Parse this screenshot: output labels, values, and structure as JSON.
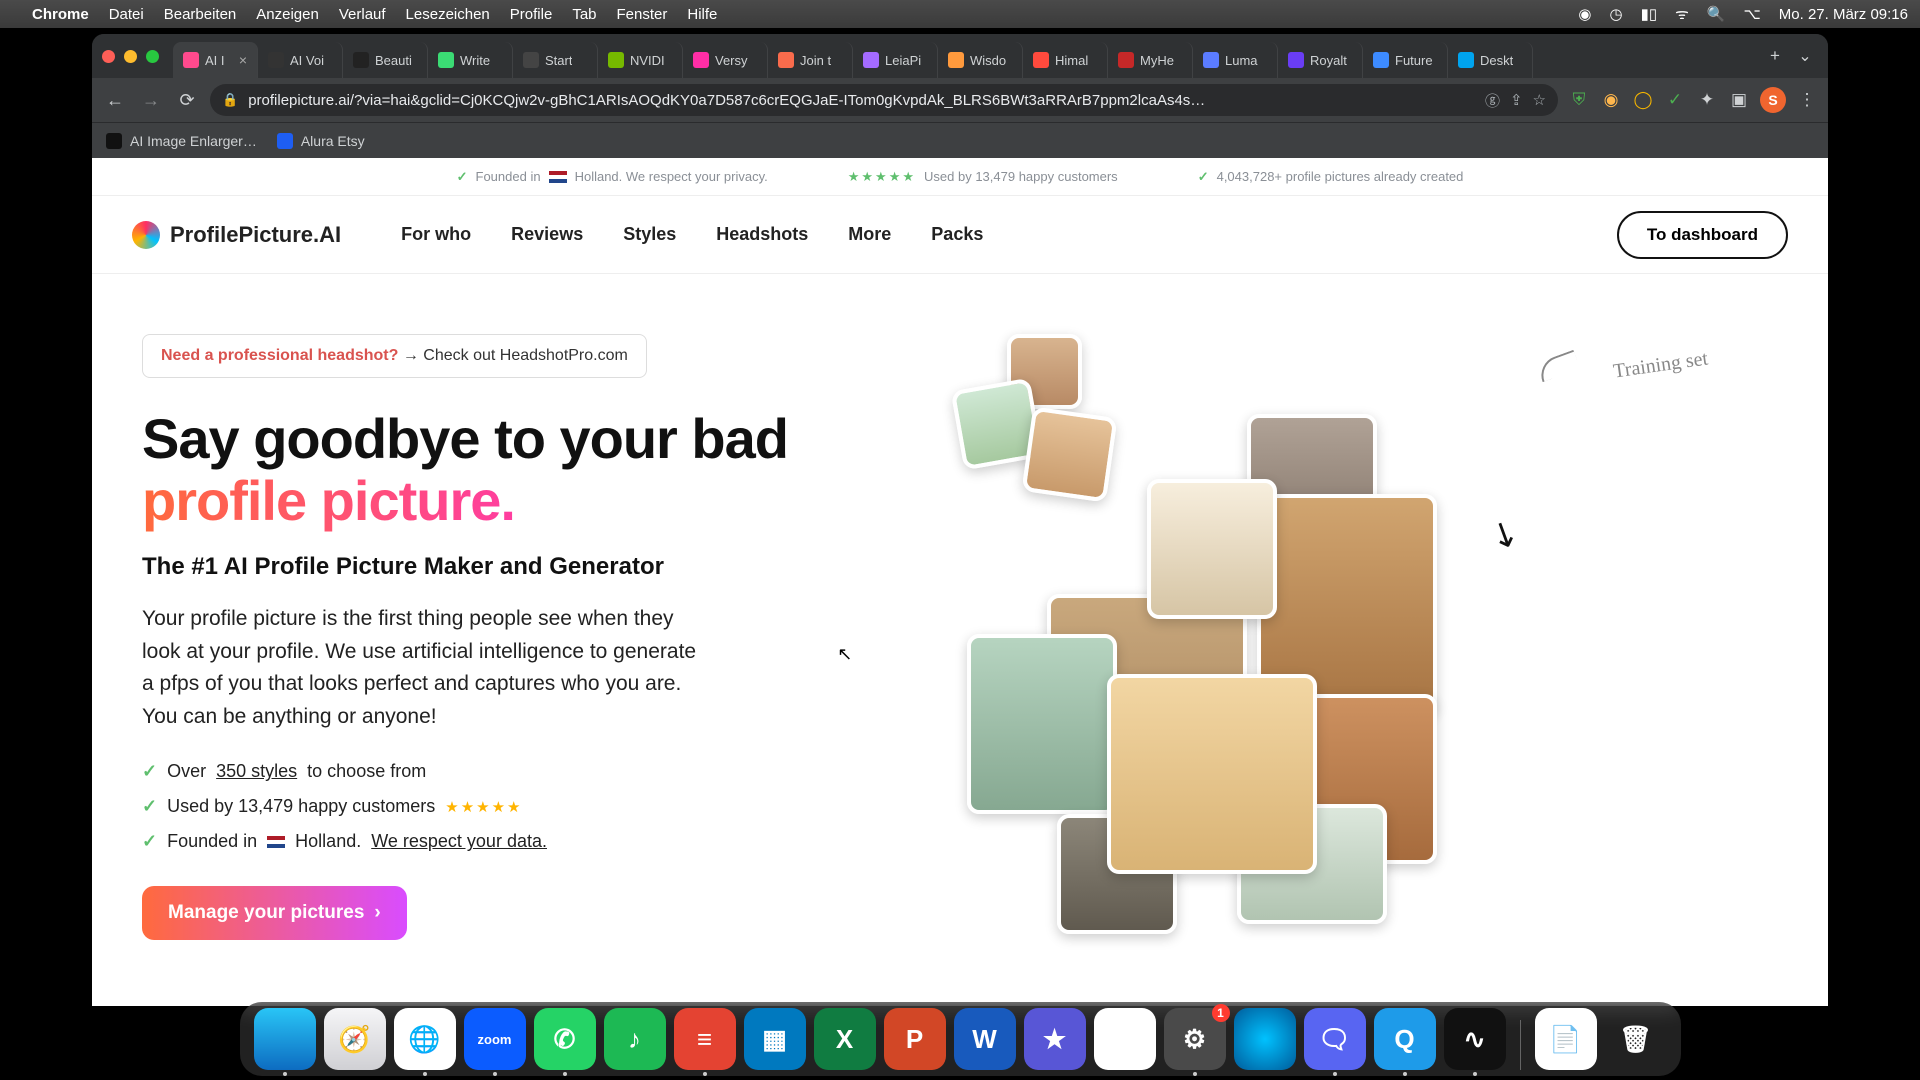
{
  "menubar": {
    "app": "Chrome",
    "items": [
      "Datei",
      "Bearbeiten",
      "Anzeigen",
      "Verlauf",
      "Lesezeichen",
      "Profile",
      "Tab",
      "Fenster",
      "Hilfe"
    ],
    "clock": "Mo. 27. März 09:16"
  },
  "tabs": [
    {
      "label": "AI I",
      "active": true,
      "favcolor": "#ff4a8d"
    },
    {
      "label": "AI Voi",
      "favcolor": "#333"
    },
    {
      "label": "Beauti",
      "favcolor": "#222"
    },
    {
      "label": "Write",
      "favcolor": "#3bdb74"
    },
    {
      "label": "Start",
      "favcolor": "#444"
    },
    {
      "label": "NVIDI",
      "favcolor": "#76b900"
    },
    {
      "label": "Versy",
      "favcolor": "#ff2ea6"
    },
    {
      "label": "Join t",
      "favcolor": "#f96b4c"
    },
    {
      "label": "LeiaPi",
      "favcolor": "#a46bff"
    },
    {
      "label": "Wisdo",
      "favcolor": "#ff9a3d"
    },
    {
      "label": "Himal",
      "favcolor": "#ff4a3d"
    },
    {
      "label": "MyHe",
      "favcolor": "#c62828"
    },
    {
      "label": "Luma",
      "favcolor": "#5b7cff"
    },
    {
      "label": "Royalt",
      "favcolor": "#6a3df5"
    },
    {
      "label": "Future",
      "favcolor": "#3d8bff"
    },
    {
      "label": "Deskt",
      "favcolor": "#00a4ef"
    }
  ],
  "url": "profilepicture.ai/?via=hai&gclid=Cj0KCQjw2v-gBhC1ARIsAOQdKY0a7D587c6crEQGJaE-ITom0gKvpdAk_BLRS6BWt3aRRArB7ppm2lcaAs4s…",
  "bookmarks": [
    {
      "label": "AI Image Enlarger…",
      "favcolor": "#111"
    },
    {
      "label": "Alura Etsy",
      "favcolor": "#1e5ef3"
    }
  ],
  "banner": {
    "privacy_pre": "Founded in",
    "privacy_post": "Holland. We respect your privacy.",
    "customers": "Used by 13,479 happy customers",
    "count": "4,043,728+ profile pictures already created"
  },
  "site": {
    "brand": "ProfilePicture.AI",
    "nav": [
      "For who",
      "Reviews",
      "Styles",
      "Headshots",
      "More",
      "Packs"
    ],
    "dash": "To dashboard"
  },
  "promo": {
    "red": "Need a professional headshot?",
    "rest": " → Check out HeadshotPro.com"
  },
  "hero": {
    "h_pre": "Say goodbye to your bad ",
    "h_grad": "profile picture.",
    "sub": "The #1 AI Profile Picture Maker and Generator",
    "para": "Your profile picture is the first thing people see when they look at your profile. We use artificial intelligence to generate a pfps of you that looks perfect and captures who you are. You can be anything or anyone!",
    "b1_pre": "Over ",
    "b1_link": "350 styles ",
    "b1_post": "to choose from",
    "b2": "Used by 13,479 happy customers",
    "b3_pre": "Founded in ",
    "b3_mid": " Holland. ",
    "b3_link": "We respect your data.",
    "cta": "Manage your pictures",
    "train": "Training set"
  },
  "dock": {
    "apps": [
      {
        "name": "finder",
        "bg": "linear-gradient(#29c5f6,#0d6cc1)",
        "txt": "",
        "dot": true
      },
      {
        "name": "safari",
        "bg": "linear-gradient(#f5f5f7,#d0d0d4)",
        "txt": "🧭",
        "dot": false
      },
      {
        "name": "chrome",
        "bg": "#fff",
        "txt": "🌐",
        "dot": true
      },
      {
        "name": "zoom",
        "bg": "#0b5cff",
        "txt": "zoom",
        "dot": true,
        "fs": "13px"
      },
      {
        "name": "whatsapp",
        "bg": "#25d366",
        "txt": "✆",
        "dot": true
      },
      {
        "name": "spotify",
        "bg": "#1db954",
        "txt": "♪",
        "dot": false
      },
      {
        "name": "todoist",
        "bg": "#e44332",
        "txt": "≡",
        "dot": true
      },
      {
        "name": "trello",
        "bg": "#0079bf",
        "txt": "▦",
        "dot": false
      },
      {
        "name": "excel",
        "bg": "#107c41",
        "txt": "X",
        "dot": false
      },
      {
        "name": "powerpoint",
        "bg": "#d24726",
        "txt": "P",
        "dot": false
      },
      {
        "name": "word",
        "bg": "#185abd",
        "txt": "W",
        "dot": false
      },
      {
        "name": "imovie",
        "bg": "#5856d6",
        "txt": "★",
        "dot": false
      },
      {
        "name": "drive",
        "bg": "#fff",
        "txt": "▲",
        "dot": false
      },
      {
        "name": "settings",
        "bg": "#4a4a4a",
        "txt": "⚙",
        "dot": true,
        "badge": "1"
      },
      {
        "name": "siri",
        "bg": "radial-gradient(circle,#00c2ff,#005b9a)",
        "txt": "",
        "dot": false
      },
      {
        "name": "discord",
        "bg": "#5865f2",
        "txt": "🗨",
        "dot": true
      },
      {
        "name": "quicktime",
        "bg": "#1e9be9",
        "txt": "Q",
        "dot": true
      },
      {
        "name": "voice",
        "bg": "#111",
        "txt": "∿",
        "dot": true
      }
    ],
    "right": [
      {
        "name": "preview-doc",
        "bg": "#fff",
        "txt": "📄"
      },
      {
        "name": "trash",
        "bg": "transparent",
        "txt": "🗑"
      }
    ]
  },
  "avatar_initial": "S"
}
